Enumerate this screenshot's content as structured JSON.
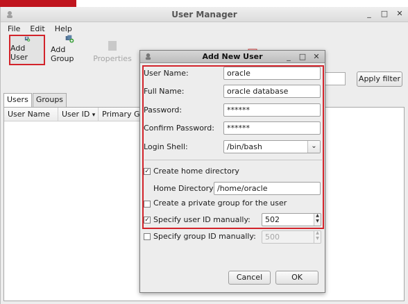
{
  "window": {
    "title": "User Manager"
  },
  "menu": {
    "file": "File",
    "edit": "Edit",
    "help": "Help"
  },
  "toolbar": {
    "add_user": "Add User",
    "add_group": "Add Group",
    "properties": "Properties"
  },
  "filter": {
    "apply_label": "Apply filter",
    "value": ""
  },
  "tabs": {
    "users": "Users",
    "groups": "Groups"
  },
  "columns": {
    "user_name": "User Name",
    "user_id": "User ID",
    "primary_group": "Primary Gro"
  },
  "dialog": {
    "title": "Add New User",
    "user_name_label": "User Name:",
    "user_name_value": "oracle",
    "full_name_label": "Full Name:",
    "full_name_value": "oracle database",
    "password_label": "Password:",
    "password_value": "******",
    "confirm_label": "Confirm Password:",
    "confirm_value": "******",
    "shell_label": "Login Shell:",
    "shell_value": "/bin/bash",
    "create_home_label": "Create home directory",
    "home_dir_label": "Home Directory:",
    "home_dir_value": "/home/oracle",
    "private_group_label": "Create a private group for the user",
    "specify_uid_label": "Specify user ID manually:",
    "uid_value": "502",
    "specify_gid_label": "Specify group ID manually:",
    "gid_value": "500",
    "cancel_label": "Cancel",
    "ok_label": "OK",
    "create_home_checked": true,
    "private_group_checked": false,
    "specify_uid_checked": true,
    "specify_gid_checked": false
  },
  "colors": {
    "highlight": "#d2232a",
    "desktop": "#c0151e"
  }
}
